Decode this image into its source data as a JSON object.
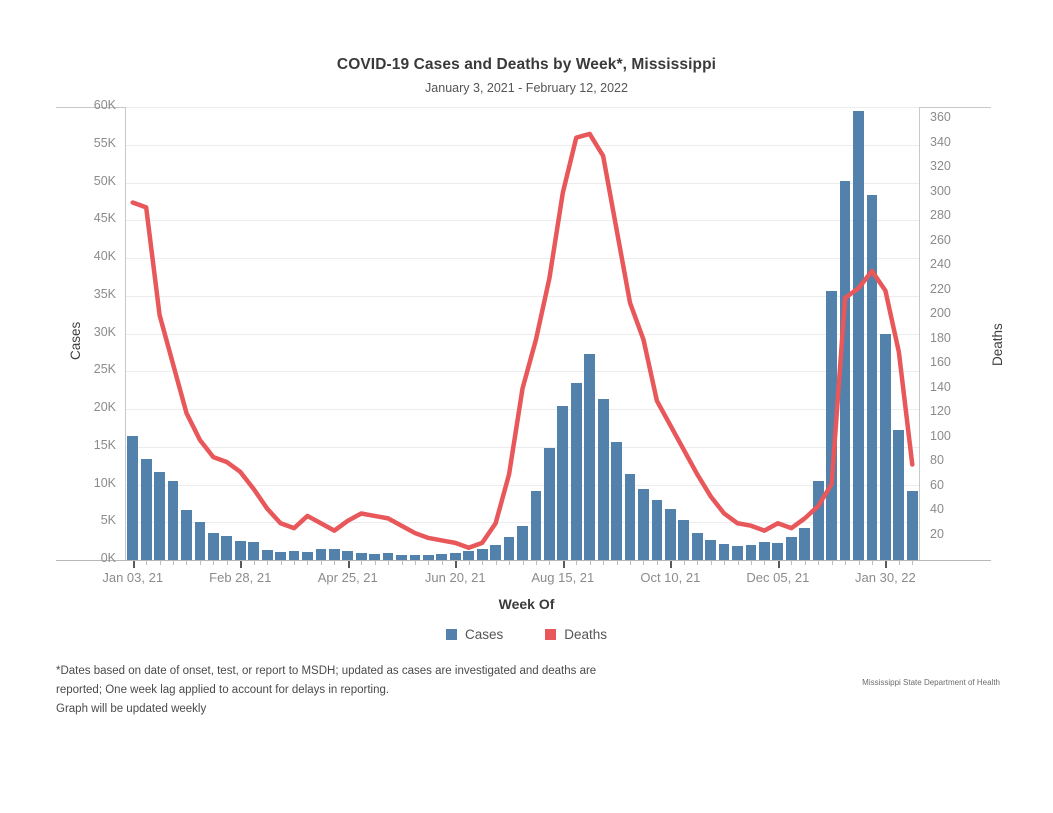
{
  "header": {
    "title": "COVID-19 Cases and Deaths by Week*, Mississippi",
    "subtitle": "January 3, 2021 - February 12, 2022"
  },
  "legend": {
    "items": [
      {
        "label": "Cases",
        "color": "#5281ab",
        "name": "legend-cases"
      },
      {
        "label": "Deaths",
        "color": "#e8575a",
        "name": "legend-deaths"
      }
    ]
  },
  "footer": {
    "note_line1": "*Dates based on date of onset, test, or report to MSDH; updated as cases are investigated and deaths are",
    "note_line2": "reported; One week lag applied to account for delays in reporting.",
    "note_line3": "Graph will be updated weekly",
    "attribution": "Mississippi State Department of Health"
  },
  "chart_data": {
    "type": "bar",
    "title": "COVID-19 Cases and Deaths by Week*, Mississippi",
    "subtitle": "January 3, 2021 - February 12, 2022",
    "xlabel": "Week Of",
    "ylabel": "Cases",
    "y2label": "Deaths",
    "ylim": [
      0,
      60000
    ],
    "y2lim": [
      0,
      370
    ],
    "grid": true,
    "legend_position": "bottom",
    "y_ticks": [
      "0K",
      "5K",
      "10K",
      "15K",
      "20K",
      "25K",
      "30K",
      "35K",
      "40K",
      "45K",
      "50K",
      "55K",
      "60K"
    ],
    "y_tick_values": [
      0,
      5000,
      10000,
      15000,
      20000,
      25000,
      30000,
      35000,
      40000,
      45000,
      50000,
      55000,
      60000
    ],
    "y2_ticks": [
      "20",
      "40",
      "60",
      "80",
      "100",
      "120",
      "140",
      "160",
      "180",
      "200",
      "220",
      "240",
      "260",
      "280",
      "300",
      "320",
      "340",
      "360"
    ],
    "y2_tick_values": [
      20,
      40,
      60,
      80,
      100,
      120,
      140,
      160,
      180,
      200,
      220,
      240,
      260,
      280,
      300,
      320,
      340,
      360
    ],
    "x_tick_labels": [
      "Jan 03, 21",
      "Feb 28, 21",
      "Apr 25, 21",
      "Jun 20, 21",
      "Aug 15, 21",
      "Oct 10, 21",
      "Dec 05, 21",
      "Jan 30, 22"
    ],
    "x_tick_indices": [
      0,
      8,
      16,
      24,
      32,
      40,
      48,
      56
    ],
    "categories": [
      "Jan 03, 21",
      "Jan 10, 21",
      "Jan 17, 21",
      "Jan 24, 21",
      "Jan 31, 21",
      "Feb 07, 21",
      "Feb 14, 21",
      "Feb 21, 21",
      "Feb 28, 21",
      "Mar 07, 21",
      "Mar 14, 21",
      "Mar 21, 21",
      "Mar 28, 21",
      "Apr 04, 21",
      "Apr 11, 21",
      "Apr 18, 21",
      "Apr 25, 21",
      "May 02, 21",
      "May 09, 21",
      "May 16, 21",
      "May 23, 21",
      "May 30, 21",
      "Jun 06, 21",
      "Jun 13, 21",
      "Jun 20, 21",
      "Jun 27, 21",
      "Jul 04, 21",
      "Jul 11, 21",
      "Jul 18, 21",
      "Jul 25, 21",
      "Aug 01, 21",
      "Aug 08, 21",
      "Aug 15, 21",
      "Aug 22, 21",
      "Aug 29, 21",
      "Sep 05, 21",
      "Sep 12, 21",
      "Sep 19, 21",
      "Sep 26, 21",
      "Oct 03, 21",
      "Oct 10, 21",
      "Oct 17, 21",
      "Oct 24, 21",
      "Oct 31, 21",
      "Nov 07, 21",
      "Nov 14, 21",
      "Nov 21, 21",
      "Nov 28, 21",
      "Dec 05, 21",
      "Dec 12, 21",
      "Dec 19, 21",
      "Dec 26, 21",
      "Jan 02, 22",
      "Jan 09, 22",
      "Jan 16, 22",
      "Jan 23, 22",
      "Jan 30, 22",
      "Feb 06, 22",
      "Feb 12, 22"
    ],
    "series": [
      {
        "name": "Cases",
        "type": "bar",
        "axis": "left",
        "color": "#5281ab",
        "values": [
          16400,
          13400,
          11700,
          10400,
          6600,
          5000,
          3600,
          3200,
          2500,
          2400,
          1300,
          1100,
          1200,
          1100,
          1400,
          1500,
          1200,
          900,
          800,
          900,
          700,
          600,
          700,
          800,
          900,
          1200,
          1500,
          2000,
          3000,
          4500,
          9100,
          14800,
          20400,
          23500,
          27300,
          21300,
          15600,
          11400,
          9400,
          8000,
          6800,
          5300,
          3600,
          2600,
          2100,
          1900,
          2000,
          2400,
          2200,
          3100,
          4300,
          10400,
          35600,
          50200,
          59500,
          48300,
          30000,
          17200,
          9200
        ]
      },
      {
        "name": "Deaths",
        "type": "line",
        "axis": "right",
        "color": "#e8575a",
        "values": [
          292,
          288,
          200,
          160,
          120,
          98,
          84,
          80,
          72,
          58,
          42,
          30,
          26,
          36,
          30,
          24,
          32,
          38,
          36,
          34,
          28,
          22,
          18,
          16,
          14,
          10,
          14,
          30,
          70,
          140,
          180,
          230,
          300,
          345,
          348,
          330,
          270,
          210,
          180,
          130,
          110,
          90,
          70,
          52,
          38,
          30,
          28,
          24,
          30,
          26,
          34,
          44,
          62,
          214,
          222,
          236,
          220,
          170,
          78
        ]
      }
    ]
  }
}
